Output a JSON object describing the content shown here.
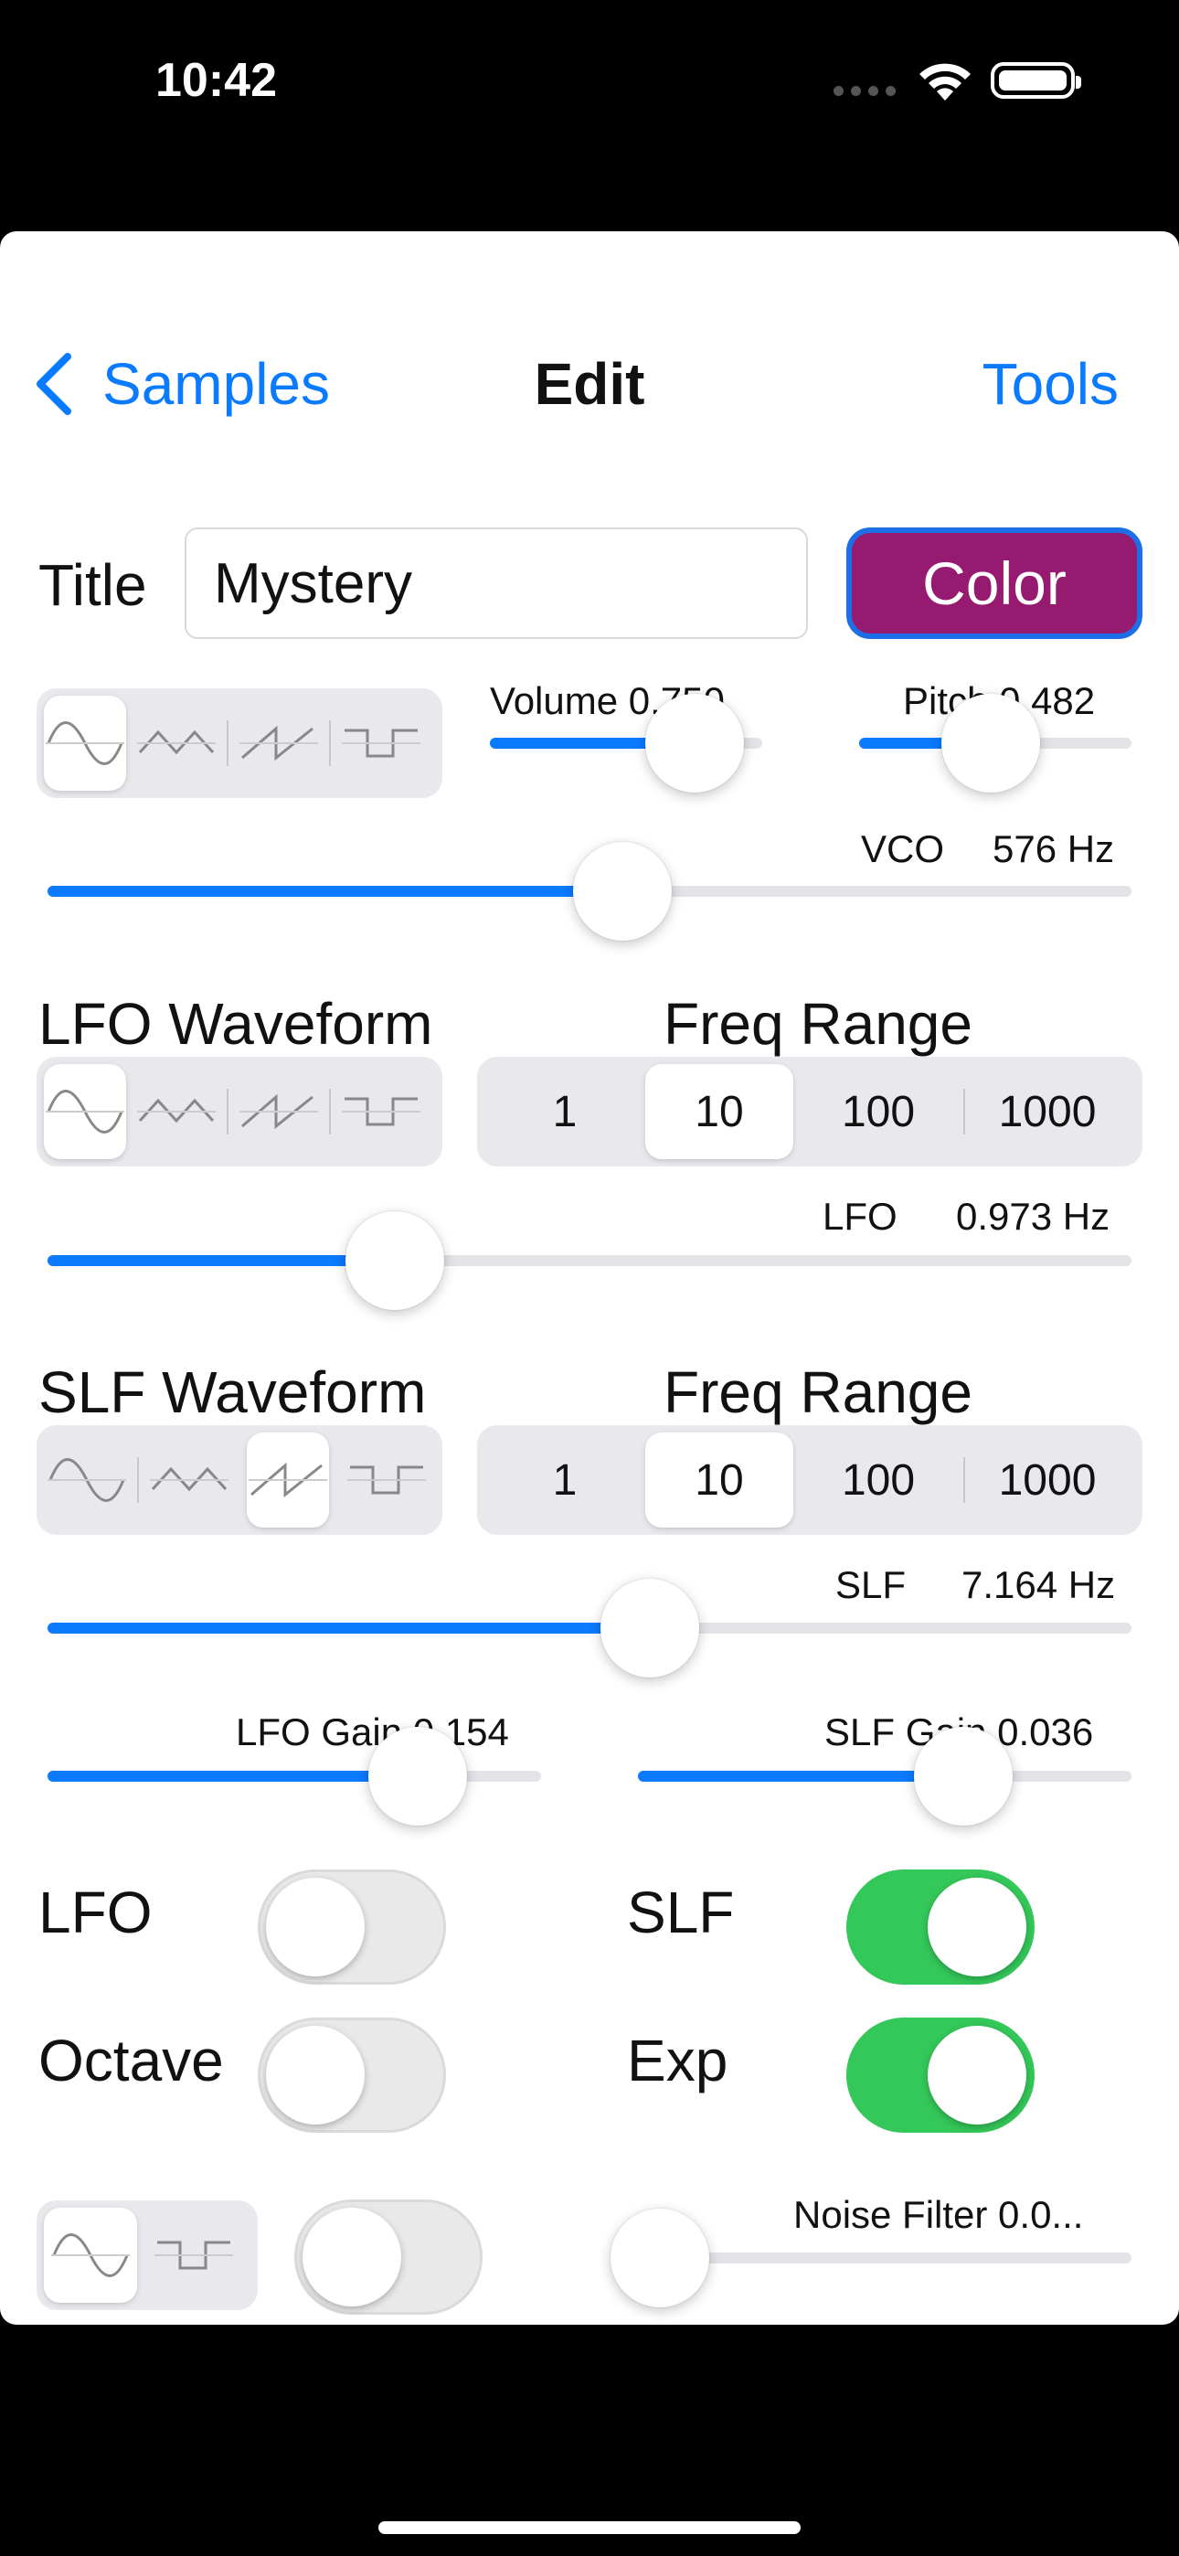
{
  "status_bar": {
    "time": "10:42"
  },
  "nav": {
    "back_label": "Samples",
    "title": "Edit",
    "tools_label": "Tools"
  },
  "title_row": {
    "label": "Title",
    "value": "Mystery",
    "color_button": "Color",
    "color_button_bg": "#951a70"
  },
  "vco": {
    "waveform_selected": 0,
    "waveforms": [
      "sine-wave-icon",
      "triangle-wave-icon",
      "sawtooth-wave-icon",
      "square-wave-icon"
    ],
    "volume_label": "Volume 0.750",
    "volume": 0.75,
    "pitch_label": "Pitch 0.482",
    "pitch": 0.482,
    "freq_name": "VCO",
    "freq_value": "576 Hz",
    "freq_position": 0.53
  },
  "lfo": {
    "waveform_label": "LFO Waveform",
    "range_label": "Freq Range",
    "waveform_selected": 0,
    "ranges": [
      "1",
      "10",
      "100",
      "1000"
    ],
    "range_selected": 1,
    "freq_name": "LFO",
    "freq_value": "0.973 Hz",
    "freq_position": 0.32
  },
  "slf": {
    "waveform_label": "SLF Waveform",
    "range_label": "Freq Range",
    "waveform_selected": 2,
    "ranges": [
      "1",
      "10",
      "100",
      "1000"
    ],
    "range_selected": 1,
    "freq_name": "SLF",
    "freq_value": "7.164 Hz",
    "freq_position": 0.556
  },
  "gains": {
    "lfo_gain_label": "LFO Gain 0.154",
    "lfo_gain": 0.75,
    "slf_gain_label": "SLF Gain 0.036",
    "slf_gain": 0.66
  },
  "toggles": {
    "lfo_label": "LFO",
    "lfo_on": false,
    "slf_label": "SLF",
    "slf_on": true,
    "octave_label": "Octave",
    "octave_on": false,
    "exp_label": "Exp",
    "exp_on": true
  },
  "noise": {
    "waveform_selected": 0,
    "waveforms": [
      "sine-wave-icon",
      "square-wave-icon"
    ],
    "toggle_on": false,
    "filter_label": "Noise Filter 0.0...",
    "filter": 0.0
  },
  "colors": {
    "accent": "#0a7aff",
    "toggle_on": "#34c759",
    "track": "#e3e3e8"
  }
}
